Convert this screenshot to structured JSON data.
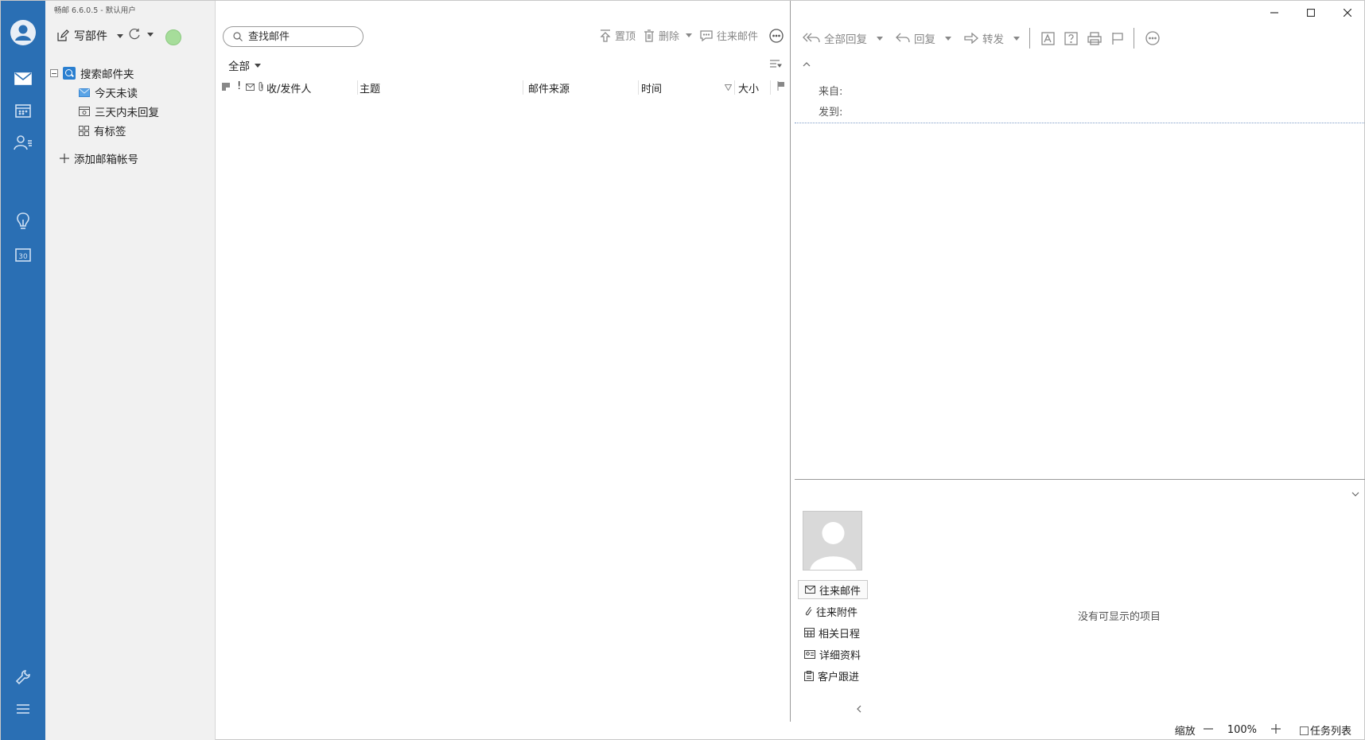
{
  "app": {
    "title": "畅邮 6.6.0.5  -  默认用户"
  },
  "rail": {
    "items": [
      {
        "icon": "user-avatar-icon"
      },
      {
        "icon": "mail-icon"
      },
      {
        "icon": "calendar-icon"
      },
      {
        "icon": "contacts-icon"
      },
      {
        "icon": "lightbulb-icon"
      },
      {
        "icon": "date-30-icon",
        "label": "30"
      },
      {
        "icon": "wrench-icon"
      },
      {
        "icon": "menu-icon"
      }
    ],
    "accent": "#2a6fb4"
  },
  "folders": {
    "compose_label": "写部件",
    "status_color": "#a6dd9a",
    "search_folder": "搜索邮件夹",
    "items": [
      {
        "label": "今天未读",
        "icon": "unread-mail-icon"
      },
      {
        "label": "三天内未回复",
        "icon": "pending-reply-icon"
      },
      {
        "label": "有标签",
        "icon": "tags-grid-icon"
      }
    ],
    "add_account": "添加邮箱帐号"
  },
  "list": {
    "search_placeholder": "查找邮件",
    "tools": {
      "pin": "置顶",
      "delete": "删除",
      "conversation": "往来邮件"
    },
    "filter": "全部",
    "columns": {
      "flag_icon": "!",
      "from": "收/发件人",
      "subject": "主题",
      "source": "邮件来源",
      "time": "时间",
      "size": "大小"
    }
  },
  "reader": {
    "tools": {
      "reply_all": "全部回复",
      "reply": "回复",
      "forward": "转发"
    },
    "from_label": "来自:",
    "to_label": "发到:",
    "links": [
      {
        "label": "往来邮件",
        "icon": "envelope-icon",
        "selected": true
      },
      {
        "label": "往来附件",
        "icon": "paperclip-icon",
        "selected": false
      },
      {
        "label": "相关日程",
        "icon": "calendar-grid-icon",
        "selected": false
      },
      {
        "label": "详细资料",
        "icon": "id-card-icon",
        "selected": false
      },
      {
        "label": "客户跟进",
        "icon": "clipboard-icon",
        "selected": false
      }
    ],
    "empty_message": "没有可显示的项目"
  },
  "status": {
    "zoom_label": "缩放",
    "zoom_value": "100%",
    "task_list": "任务列表"
  }
}
